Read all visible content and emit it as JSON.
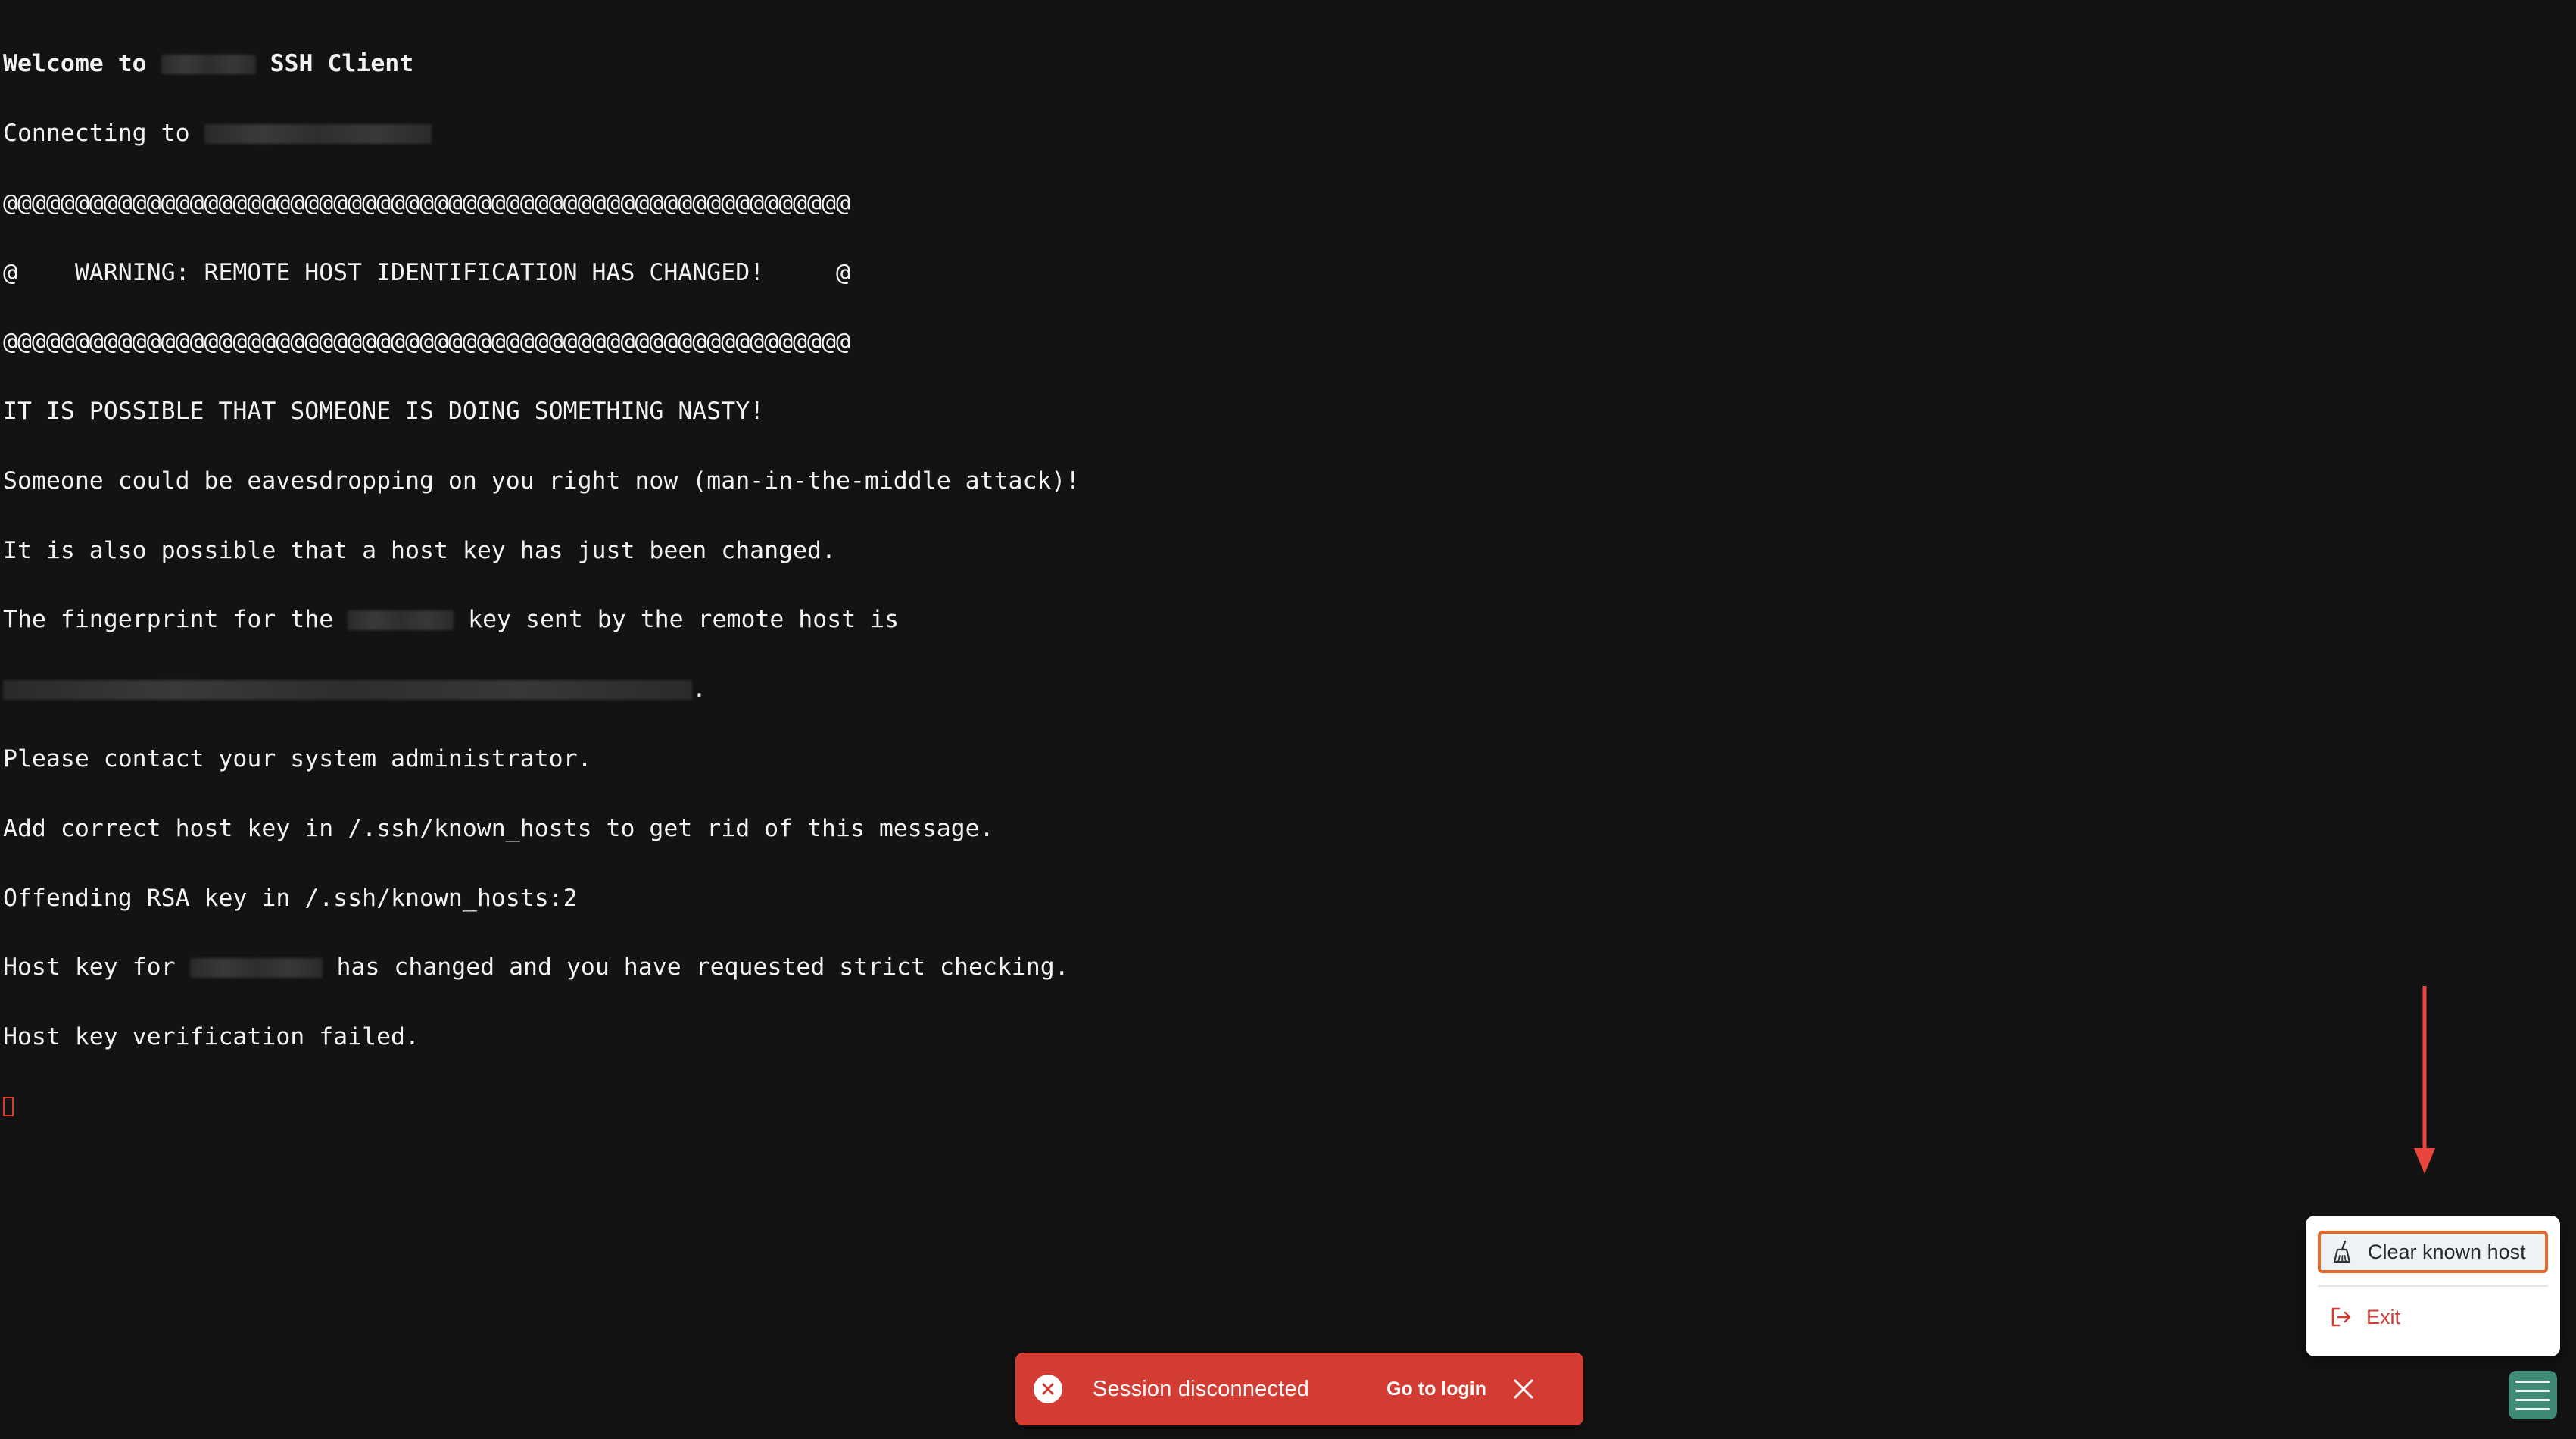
{
  "terminal": {
    "welcome_prefix": "Welcome to ",
    "welcome_suffix": " SSH Client",
    "connecting": "Connecting to ",
    "at_line": "@@@@@@@@@@@@@@@@@@@@@@@@@@@@@@@@@@@@@@@@@@@@@@@@@@@@@@@@@@@",
    "warning_line": "@    WARNING: REMOTE HOST IDENTIFICATION HAS CHANGED!     @",
    "nasty_line": "IT IS POSSIBLE THAT SOMEONE IS DOING SOMETHING NASTY!",
    "eavesdrop_line": "Someone could be eavesdropping on you right now (man-in-the-middle attack)!",
    "host_key_changed_line": "It is also possible that a host key has just been changed.",
    "fingerprint_prefix": "The fingerprint for the ",
    "fingerprint_suffix": " key sent by the remote host is",
    "fingerprint_end": ".",
    "contact_admin": "Please contact your system administrator.",
    "add_correct": "Add correct host key in /.ssh/known_hosts to get rid of this message.",
    "offending": "Offending RSA key in /.ssh/known_hosts:2",
    "host_key_for_prefix": "Host key for ",
    "host_key_for_suffix": " has changed and you have requested strict checking.",
    "verification_failed": "Host key verification failed."
  },
  "toast": {
    "message": "Session disconnected",
    "action_label": "Go to login",
    "icon": "error-circle-icon",
    "close_icon": "close-icon",
    "color": "#d33c33"
  },
  "menu": {
    "clear_known_host_label": "Clear known host",
    "clear_known_host_icon": "broom-icon",
    "exit_label": "Exit",
    "exit_icon": "logout-icon",
    "highlight_color": "#e5692b",
    "exit_color": "#d33c33"
  },
  "fab": {
    "icon": "hamburger-menu-icon",
    "color": "#3e8a74"
  },
  "annotation": {
    "arrow_color": "#e8453c"
  }
}
